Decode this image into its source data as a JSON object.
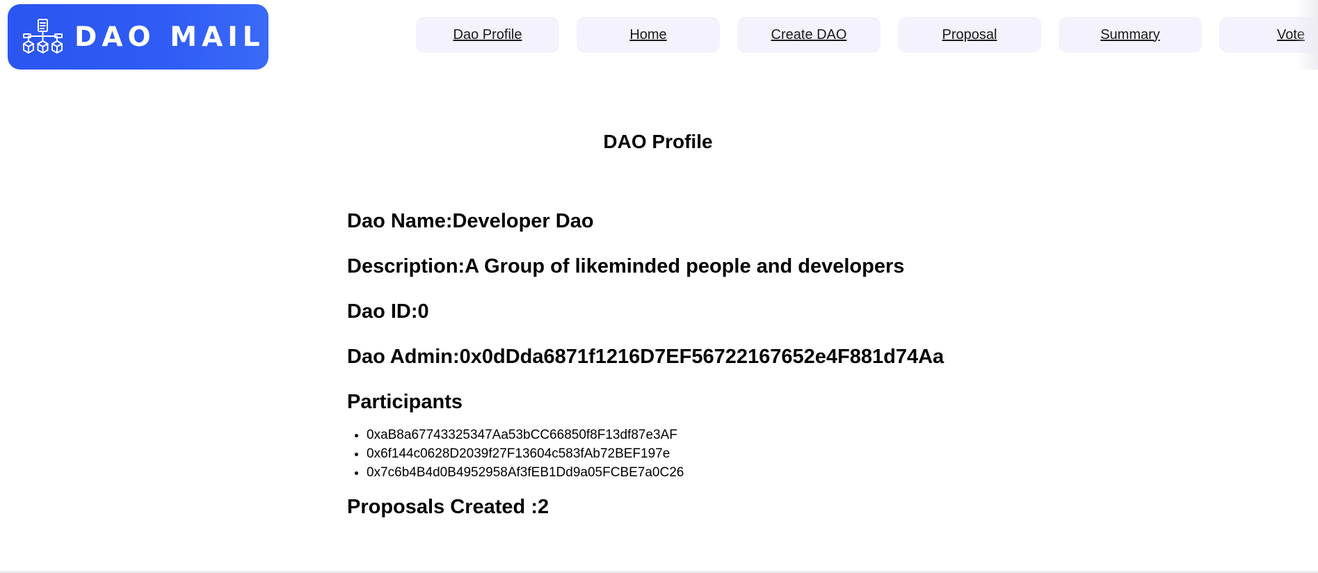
{
  "header": {
    "logo_text": "DAO MAIL",
    "logo_icon": "blockchain-network-icon",
    "nav": [
      {
        "label": "Dao Profile"
      },
      {
        "label": "Home"
      },
      {
        "label": "Create DAO"
      },
      {
        "label": "Proposal"
      },
      {
        "label": "Summary"
      },
      {
        "label": "Vote"
      }
    ]
  },
  "main": {
    "title": "DAO Profile",
    "dao_name": "Dao Name:Developer Dao",
    "description": "Description:A Group of likeminded people and developers",
    "dao_id": "Dao ID:0",
    "dao_admin": "Dao Admin:0x0dDda6871f1216D7EF56722167652e4F881d74Aa",
    "participants_title": "Participants",
    "participants": [
      "0xaB8a67743325347Aa53bCC66850f8F13df87e3AF",
      "0x6f144c0628D2039f27F13604c583fAb72BEF197e",
      "0x7c6b4B4d0B4952958Af3fEB1Dd9a05FCBE7a0C26"
    ],
    "proposals_created": "Proposals Created :2"
  },
  "colors": {
    "brand": "#2f5cf5",
    "nav_bg": "#f4f2fd"
  }
}
